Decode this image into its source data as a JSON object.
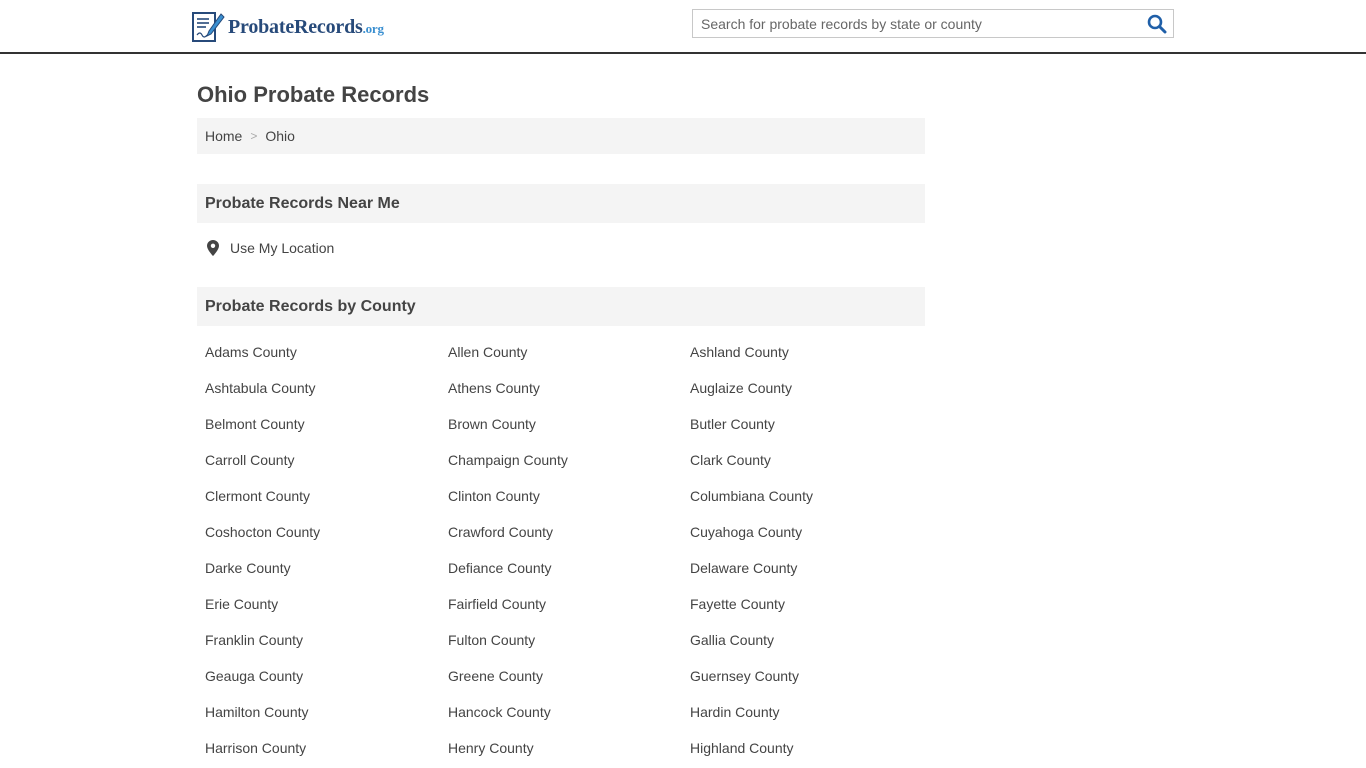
{
  "header": {
    "logo_main": "ProbateRecords",
    "logo_tld": ".org",
    "search_placeholder": "Search for probate records by state or county",
    "search_icon": "search-icon",
    "logo_icon": "document-pen-icon"
  },
  "page": {
    "title": "Ohio Probate Records"
  },
  "breadcrumb": {
    "items": [
      "Home",
      "Ohio"
    ],
    "separator": ">"
  },
  "near_me": {
    "heading": "Probate Records Near Me",
    "location_label": "Use My Location",
    "location_icon": "map-pin-icon"
  },
  "by_county": {
    "heading": "Probate Records by County",
    "counties": [
      "Adams County",
      "Allen County",
      "Ashland County",
      "Ashtabula County",
      "Athens County",
      "Auglaize County",
      "Belmont County",
      "Brown County",
      "Butler County",
      "Carroll County",
      "Champaign County",
      "Clark County",
      "Clermont County",
      "Clinton County",
      "Columbiana County",
      "Coshocton County",
      "Crawford County",
      "Cuyahoga County",
      "Darke County",
      "Defiance County",
      "Delaware County",
      "Erie County",
      "Fairfield County",
      "Fayette County",
      "Franklin County",
      "Fulton County",
      "Gallia County",
      "Geauga County",
      "Greene County",
      "Guernsey County",
      "Hamilton County",
      "Hancock County",
      "Hardin County",
      "Harrison County",
      "Henry County",
      "Highland County"
    ]
  },
  "colors": {
    "logo_dark": "#274a7a",
    "logo_accent": "#3a8fd0",
    "search_icon": "#1f5fa8",
    "section_bg": "#f4f4f4",
    "text": "#444444"
  }
}
